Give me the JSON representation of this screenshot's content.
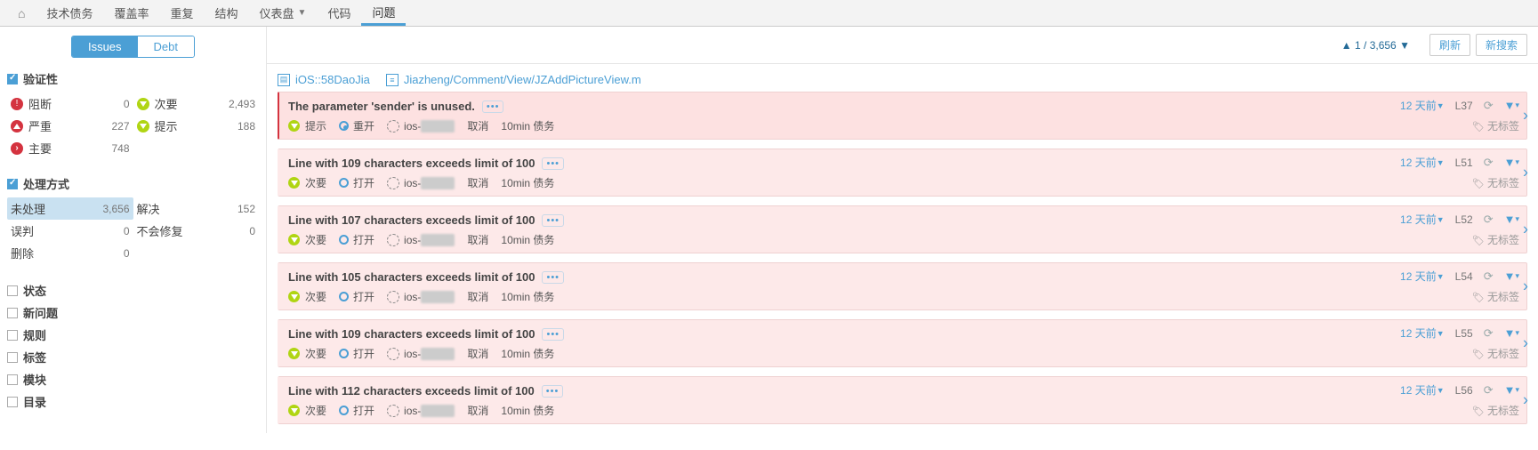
{
  "nav": {
    "home_icon": "⌂",
    "items": [
      "技术债务",
      "覆盖率",
      "重复",
      "结构",
      "仪表盘",
      "代码",
      "问题"
    ],
    "dropdown_index": 4,
    "active_index": 6
  },
  "sidebar": {
    "toggle": {
      "issues": "Issues",
      "debt": "Debt",
      "active": 0
    },
    "severity": {
      "title": "验证性",
      "left": [
        {
          "key": "blocker",
          "label": "阻断",
          "count": "0",
          "color": "sev-blocker",
          "glyph": "!"
        },
        {
          "key": "critical",
          "label": "严重",
          "count": "227",
          "color": "sev-critical",
          "glyph": "▲"
        },
        {
          "key": "major",
          "label": "主要",
          "count": "748",
          "color": "sev-major",
          "glyph": "▸"
        }
      ],
      "right": [
        {
          "key": "minor",
          "label": "次要",
          "count": "2,493",
          "color": "sev-minor",
          "glyph": "▾"
        },
        {
          "key": "info",
          "label": "提示",
          "count": "188",
          "color": "sev-info",
          "glyph": "▾"
        }
      ]
    },
    "resolution": {
      "title": "处理方式",
      "left": [
        {
          "label": "未处理",
          "count": "3,656",
          "selected": true
        },
        {
          "label": "误判",
          "count": "0"
        },
        {
          "label": "删除",
          "count": "0"
        }
      ],
      "right": [
        {
          "label": "解决",
          "count": "152"
        },
        {
          "label": "不会修复",
          "count": "0"
        }
      ]
    },
    "facets": [
      "状态",
      "新问题",
      "规则",
      "标签",
      "模块",
      "目录"
    ]
  },
  "header": {
    "paging": "1 / 3,656",
    "refresh": "刷新",
    "new_search": "新搜索"
  },
  "breadcrumb": {
    "project": "iOS::58DaoJia",
    "file": "Jiazheng/Comment/View/JZAddPictureView.m"
  },
  "issues": [
    {
      "title": "The parameter 'sender' is unused.",
      "severity": {
        "label": "提示",
        "color": "sev-info"
      },
      "status": {
        "label": "重开",
        "kind": "reopened"
      },
      "assignee_prefix": "ios-",
      "action": "取消",
      "debt": "10min 债务",
      "age": "12 天前",
      "line": "L37",
      "tags": "无标签",
      "selected": true
    },
    {
      "title": "Line with 109 characters exceeds limit of 100",
      "severity": {
        "label": "次要",
        "color": "sev-minor"
      },
      "status": {
        "label": "打开",
        "kind": "open"
      },
      "assignee_prefix": "ios-",
      "action": "取消",
      "debt": "10min 债务",
      "age": "12 天前",
      "line": "L51",
      "tags": "无标签"
    },
    {
      "title": "Line with 107 characters exceeds limit of 100",
      "severity": {
        "label": "次要",
        "color": "sev-minor"
      },
      "status": {
        "label": "打开",
        "kind": "open"
      },
      "assignee_prefix": "ios-",
      "action": "取消",
      "debt": "10min 债务",
      "age": "12 天前",
      "line": "L52",
      "tags": "无标签"
    },
    {
      "title": "Line with 105 characters exceeds limit of 100",
      "severity": {
        "label": "次要",
        "color": "sev-minor"
      },
      "status": {
        "label": "打开",
        "kind": "open"
      },
      "assignee_prefix": "ios-",
      "action": "取消",
      "debt": "10min 债务",
      "age": "12 天前",
      "line": "L54",
      "tags": "无标签"
    },
    {
      "title": "Line with 109 characters exceeds limit of 100",
      "severity": {
        "label": "次要",
        "color": "sev-minor"
      },
      "status": {
        "label": "打开",
        "kind": "open"
      },
      "assignee_prefix": "ios-",
      "action": "取消",
      "debt": "10min 债务",
      "age": "12 天前",
      "line": "L55",
      "tags": "无标签"
    },
    {
      "title": "Line with 112 characters exceeds limit of 100",
      "severity": {
        "label": "次要",
        "color": "sev-minor"
      },
      "status": {
        "label": "打开",
        "kind": "open"
      },
      "assignee_prefix": "ios-",
      "action": "取消",
      "debt": "10min 债务",
      "age": "12 天前",
      "line": "L56",
      "tags": "无标签"
    }
  ]
}
